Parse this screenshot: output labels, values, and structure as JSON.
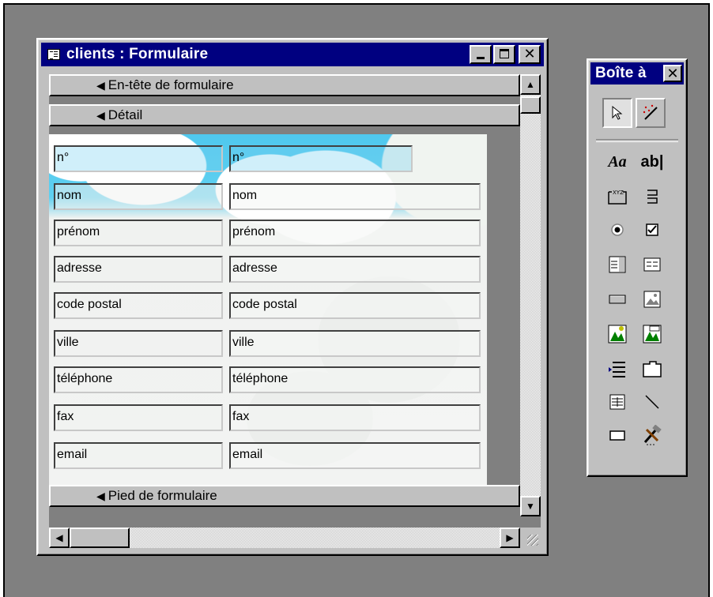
{
  "form_window": {
    "title": "clients : Formulaire",
    "controls": {
      "minimize": "minimize",
      "maximize": "maximize",
      "close": "✕"
    }
  },
  "sections": {
    "header": "En-tête de formulaire",
    "detail": "Détail",
    "footer": "Pied de formulaire"
  },
  "fields": [
    {
      "label": "n°",
      "textbox": "n°"
    },
    {
      "label": "nom",
      "textbox": "nom"
    },
    {
      "label": "prénom",
      "textbox": "prénom"
    },
    {
      "label": "adresse",
      "textbox": "adresse"
    },
    {
      "label": "code postal",
      "textbox": "code postal"
    },
    {
      "label": "ville",
      "textbox": "ville"
    },
    {
      "label": "téléphone",
      "textbox": "téléphone"
    },
    {
      "label": "fax",
      "textbox": "fax"
    },
    {
      "label": "email",
      "textbox": "email"
    }
  ],
  "toolbox": {
    "title": "Boîte à",
    "close": "✕",
    "tools": {
      "label_glyph": "Aa",
      "textbox_glyph": "ab|",
      "group_glyph": "XYZ"
    }
  },
  "colors": {
    "titlebar": "#000080",
    "chrome": "#c0c0c0",
    "workspace": "#808080",
    "sky": "#4fc8ee"
  }
}
